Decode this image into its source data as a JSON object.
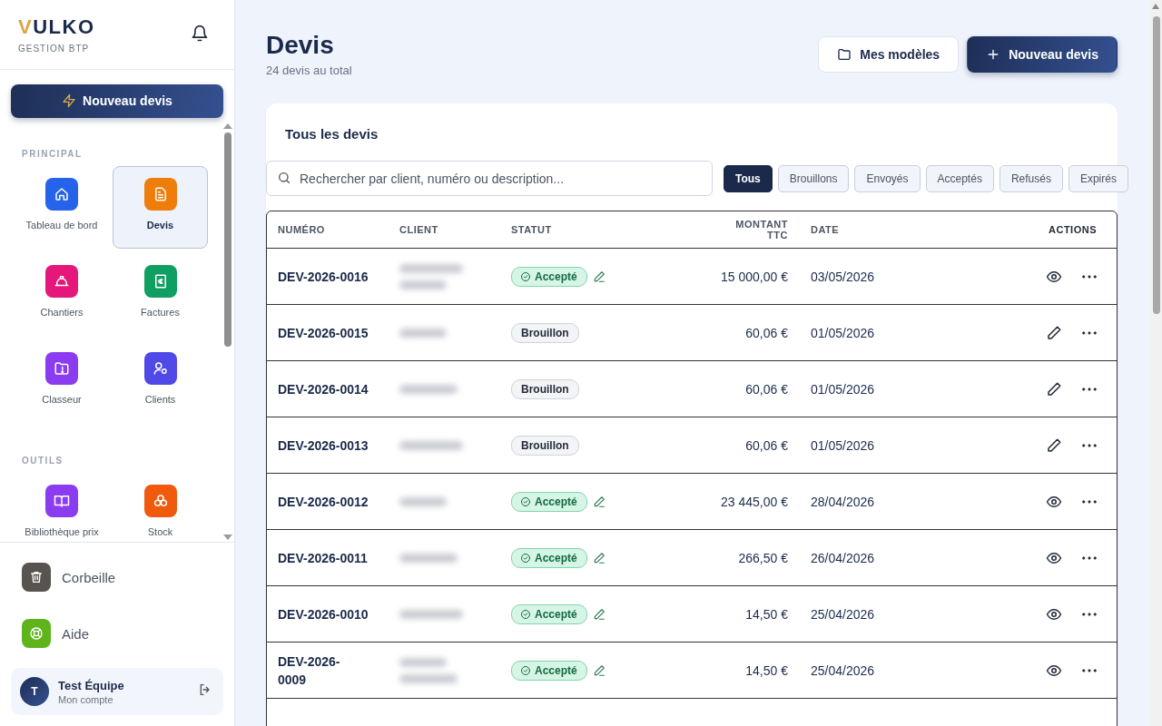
{
  "sidebar": {
    "logo": {
      "accent": "V",
      "rest": "ULKO"
    },
    "tagline": "GESTION BTP",
    "cta": "Nouveau devis",
    "sections": [
      {
        "title": "PRINCIPAL",
        "items": [
          {
            "label": "Tableau de bord",
            "color": "#2563eb",
            "selected": false
          },
          {
            "label": "Devis",
            "color": "#ef7d0a",
            "selected": true
          },
          {
            "label": "Chantiers",
            "color": "#e6177a",
            "selected": false
          },
          {
            "label": "Factures",
            "color": "#0f9f63",
            "selected": false
          },
          {
            "label": "Classeur",
            "color": "#8b3cf0",
            "selected": false
          },
          {
            "label": "Clients",
            "color": "#5148e8",
            "selected": false
          }
        ]
      },
      {
        "title": "OUTILS",
        "items": [
          {
            "label": "Bibliothèque prix",
            "color": "#8b3cf0",
            "selected": false
          },
          {
            "label": "Stock",
            "color": "#ef5a0c",
            "selected": false
          }
        ]
      }
    ],
    "footer_items": [
      {
        "label": "Corbeille",
        "color": "#57534e"
      },
      {
        "label": "Aide",
        "color": "#5fb41c"
      }
    ],
    "user": {
      "initial": "T",
      "name": "Test Équipe",
      "subtitle": "Mon compte"
    }
  },
  "header": {
    "title": "Devis",
    "subtitle": "24 devis au total",
    "buttons": [
      {
        "label": "Mes modèles",
        "kind": "secondary"
      },
      {
        "label": "Nouveau devis",
        "kind": "primary"
      }
    ]
  },
  "card": {
    "title": "Tous les devis",
    "search": {
      "placeholder": "Rechercher par client, numéro ou description..."
    },
    "filters": [
      {
        "label": "Tous",
        "selected": true
      },
      {
        "label": "Brouillons",
        "selected": false
      },
      {
        "label": "Envoyés",
        "selected": false
      },
      {
        "label": "Acceptés",
        "selected": false
      },
      {
        "label": "Refusés",
        "selected": false
      },
      {
        "label": "Expirés",
        "selected": false
      }
    ],
    "table": {
      "columns": [
        "NUMÉRO",
        "CLIENT",
        "STATUT",
        "MONTANT TTC",
        "DATE",
        "ACTIONS"
      ],
      "rows": [
        {
          "number": "DEV-2026-0016",
          "number_wrapped": false,
          "client": {
            "redacted": true,
            "multiline": true
          },
          "status": {
            "kind": "accepted",
            "label": "Accepté",
            "editable": true
          },
          "amount": "15 000,00 €",
          "date": "03/05/2026",
          "actions": [
            {
              "kind": "view"
            },
            {
              "kind": "more"
            }
          ]
        },
        {
          "number": "DEV-2026-0015",
          "number_wrapped": false,
          "client": {
            "redacted": true,
            "multiline": false
          },
          "status": {
            "kind": "draft",
            "label": "Brouillon",
            "editable": false
          },
          "amount": "60,06 €",
          "date": "01/05/2026",
          "actions": [
            {
              "kind": "edit"
            },
            {
              "kind": "more"
            }
          ]
        },
        {
          "number": "DEV-2026-0014",
          "number_wrapped": false,
          "client": {
            "redacted": true,
            "multiline": false
          },
          "status": {
            "kind": "draft",
            "label": "Brouillon",
            "editable": false
          },
          "amount": "60,06 €",
          "date": "01/05/2026",
          "actions": [
            {
              "kind": "edit"
            },
            {
              "kind": "more"
            }
          ]
        },
        {
          "number": "DEV-2026-0013",
          "number_wrapped": false,
          "client": {
            "redacted": true,
            "multiline": false
          },
          "status": {
            "kind": "draft",
            "label": "Brouillon",
            "editable": false
          },
          "amount": "60,06 €",
          "date": "01/05/2026",
          "actions": [
            {
              "kind": "edit"
            },
            {
              "kind": "more"
            }
          ]
        },
        {
          "number": "DEV-2026-0012",
          "number_wrapped": false,
          "client": {
            "redacted": true,
            "multiline": false
          },
          "status": {
            "kind": "accepted",
            "label": "Accepté",
            "editable": true
          },
          "amount": "23 445,00 €",
          "date": "28/04/2026",
          "actions": [
            {
              "kind": "view"
            },
            {
              "kind": "more"
            }
          ]
        },
        {
          "number": "DEV-2026-0011",
          "number_wrapped": false,
          "client": {
            "redacted": true,
            "multiline": false
          },
          "status": {
            "kind": "accepted",
            "label": "Accepté",
            "editable": true
          },
          "amount": "266,50 €",
          "date": "26/04/2026",
          "actions": [
            {
              "kind": "view"
            },
            {
              "kind": "more"
            }
          ]
        },
        {
          "number": "DEV-2026-0010",
          "number_wrapped": false,
          "client": {
            "redacted": true,
            "multiline": false
          },
          "status": {
            "kind": "accepted",
            "label": "Accepté",
            "editable": true
          },
          "amount": "14,50 €",
          "date": "25/04/2026",
          "actions": [
            {
              "kind": "view"
            },
            {
              "kind": "more"
            }
          ]
        },
        {
          "number": "DEV-2026-0009",
          "number_wrapped": true,
          "client": {
            "redacted": true,
            "multiline": true
          },
          "status": {
            "kind": "accepted",
            "label": "Accepté",
            "editable": true
          },
          "amount": "14,50 €",
          "date": "25/04/2026",
          "actions": [
            {
              "kind": "view"
            },
            {
              "kind": "more"
            }
          ]
        }
      ]
    }
  }
}
